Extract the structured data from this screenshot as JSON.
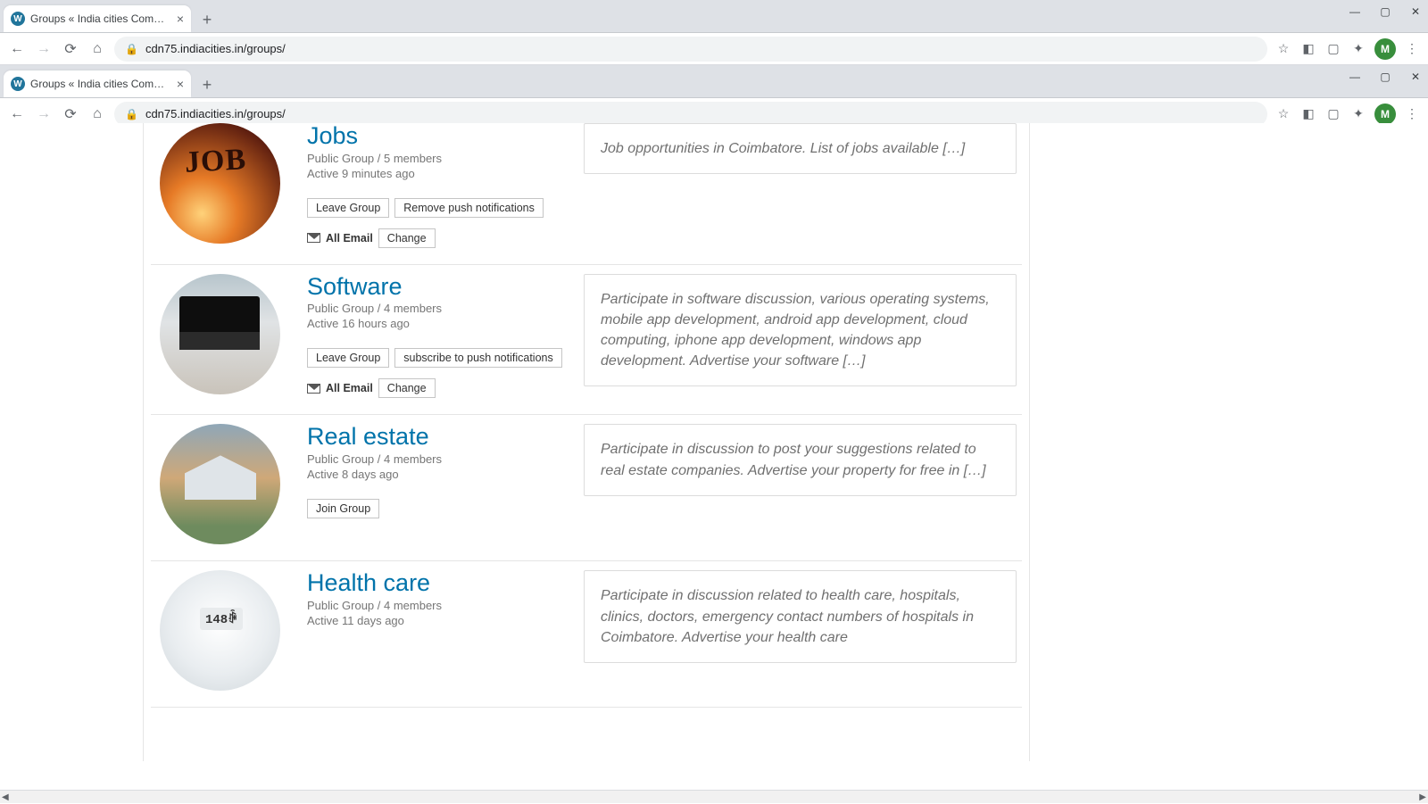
{
  "browser": {
    "tab_title": "Groups « India cities Community",
    "tab_favicon_letter": "W",
    "url": "cdn75.indiacities.in/groups/",
    "avatar_letter": "M",
    "window_controls": {
      "min": "—",
      "max": "▢",
      "close": "✕"
    },
    "newtab": "+",
    "nav": {
      "back": "←",
      "forward": "→",
      "reload": "⟳",
      "home": "⌂",
      "lock": "🔒"
    },
    "ext": {
      "star": "☆",
      "sq1": "◧",
      "sq2": "▢",
      "puzzle": "✦",
      "menu": "⋮"
    }
  },
  "groups": [
    {
      "id": "jobs",
      "title": "Jobs",
      "title_cut": true,
      "avatar_class": "av-jobs",
      "avatar_text": "JOB",
      "meta": "Public Group / 5 members",
      "active": "Active 9 minutes ago",
      "buttons": [
        "Leave Group",
        "Remove push notifications"
      ],
      "email_label": "All Email",
      "change_label": "Change",
      "desc": "Job opportunities in Coimbatore. List of jobs available […]"
    },
    {
      "id": "software",
      "title": "Software",
      "avatar_class": "av-soft",
      "meta": "Public Group / 4 members",
      "active": "Active 16 hours ago",
      "buttons": [
        "Leave Group",
        "subscribe to push notifications"
      ],
      "email_label": "All Email",
      "change_label": "Change",
      "desc": "Participate in software discussion, various operating systems, mobile app development, android app development, cloud computing, iphone app development, windows app development. Advertise your software […]"
    },
    {
      "id": "realestate",
      "title": "Real estate",
      "avatar_class": "av-real",
      "meta": "Public Group / 4 members",
      "active": "Active 8 days ago",
      "buttons": [
        "Join Group"
      ],
      "desc": "Participate in discussion to post your suggestions related to real estate companies. Advertise your property for free in […]"
    },
    {
      "id": "healthcare",
      "title": "Health care",
      "avatar_class": "av-health",
      "meta": "Public Group / 4 members",
      "active": "Active 11 days ago",
      "buttons": [],
      "desc": "Participate in discussion related to health care, hospitals, clinics, doctors, emergency contact numbers of hospitals in Coimbatore. Advertise your health care"
    }
  ]
}
